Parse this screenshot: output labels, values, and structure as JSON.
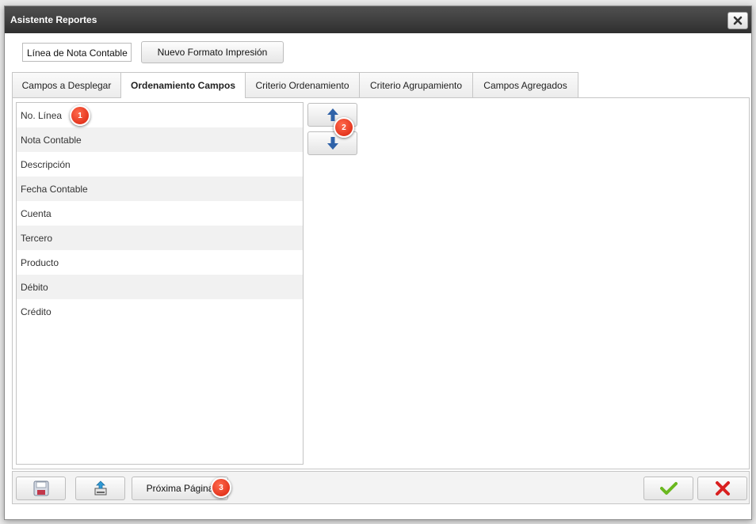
{
  "dialog": {
    "title": "Asistente Reportes"
  },
  "top": {
    "field_value": "Línea de Nota Contable",
    "new_format_label": "Nuevo Formato Impresión"
  },
  "tabs": [
    {
      "label": "Campos a Desplegar",
      "active": false
    },
    {
      "label": "Ordenamiento Campos",
      "active": true
    },
    {
      "label": "Criterio Ordenamiento",
      "active": false
    },
    {
      "label": "Criterio Agrupamiento",
      "active": false
    },
    {
      "label": "Campos Agregados",
      "active": false
    }
  ],
  "fields": [
    "No. Línea",
    "Nota Contable",
    "Descripción",
    "Fecha Contable",
    "Cuenta",
    "Tercero",
    "Producto",
    "Débito",
    "Crédito"
  ],
  "controls": {
    "move_up": "arrow-up-icon",
    "move_down": "arrow-down-icon"
  },
  "footer": {
    "next_page_label": "Próxima Página"
  },
  "markers": [
    "1",
    "2",
    "3"
  ],
  "colors": {
    "titlebar": "#3a3a3a",
    "arrow": "#2f62a8",
    "accept": "#6ab81f",
    "cancel": "#d92020",
    "marker": "#e0301a"
  }
}
